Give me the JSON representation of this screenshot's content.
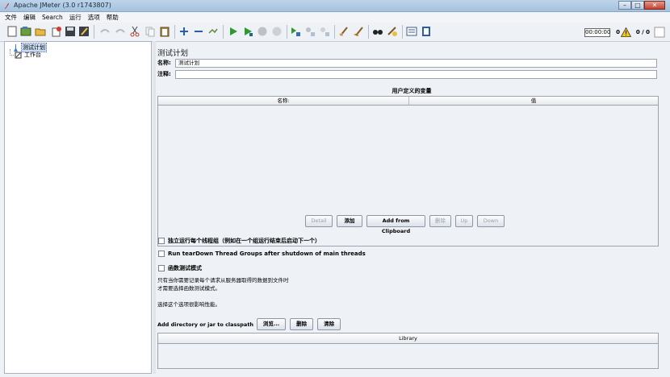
{
  "window": {
    "title": "Apache JMeter (3.0 r1743807)",
    "controls": {
      "minimize": "–",
      "maximize": "□",
      "close": "✕"
    }
  },
  "menu": [
    "文件",
    "编辑",
    "Search",
    "运行",
    "选项",
    "帮助"
  ],
  "toolbar": {
    "timer": "00:00:00",
    "error_count": "0",
    "threads": "0 / 0"
  },
  "tree": {
    "items": [
      {
        "label": "测试计划",
        "selected": true,
        "icon": "test-plan-icon"
      },
      {
        "label": "工作台",
        "selected": false,
        "icon": "workbench-icon"
      }
    ]
  },
  "panel": {
    "title": "测试计划",
    "name_label": "名称:",
    "name_value": "测试计划",
    "comment_label": "注释:",
    "comment_value": "",
    "vars_title": "用户定义的变量",
    "columns": [
      "名称:",
      "值"
    ],
    "buttons": {
      "detail": "Detail",
      "add": "添加",
      "add_clipboard": "Add from Clipboard",
      "delete": "删除",
      "up": "Up",
      "down": "Down"
    },
    "checkboxes": [
      "独立运行每个线程组（例如在一个组运行结束后启动下一个）",
      "Run tearDown Thread Groups after shutdown of main threads",
      "函数测试模式"
    ],
    "note_line1": "只有当你需要记录每个请求从服务器取得的数据到文件时",
    "note_line2": "才需要选择函数测试模式。",
    "note_line3": "选择这个选项很影响性能。",
    "classpath_label": "Add directory or jar to classpath",
    "classpath_buttons": {
      "browse": "浏览...",
      "delete": "删除",
      "clear": "清除"
    },
    "library_header": "Library"
  }
}
